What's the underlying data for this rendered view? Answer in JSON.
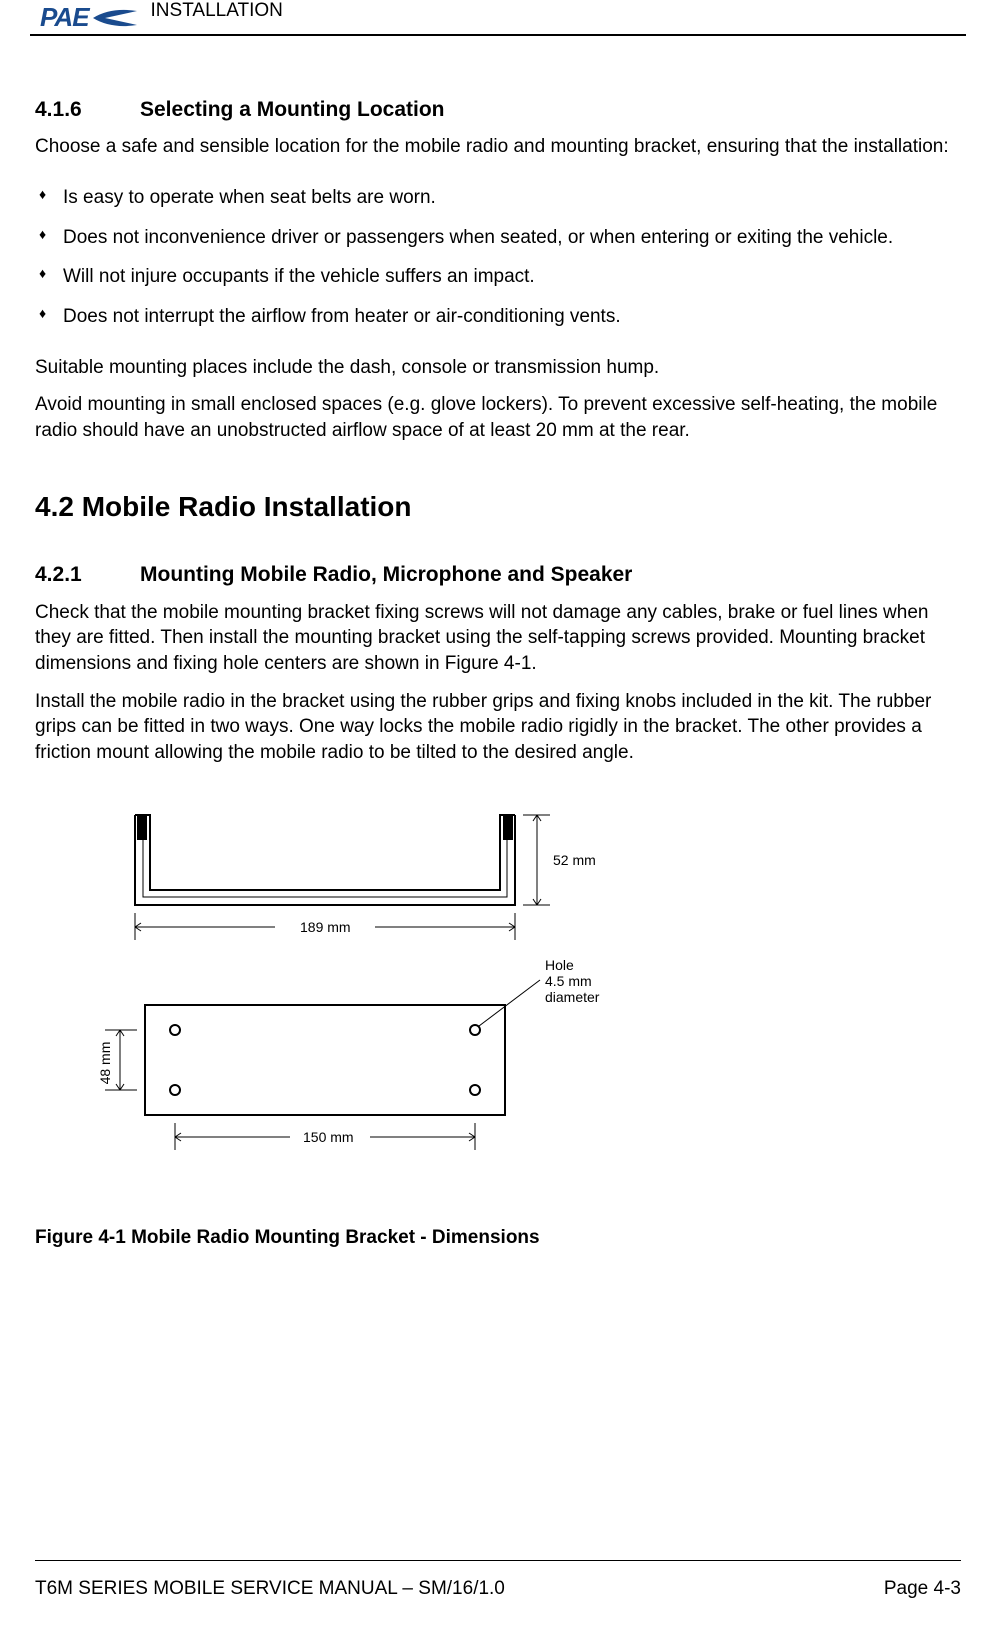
{
  "header": {
    "logo_text": "PAE",
    "title": "INSTALLATION"
  },
  "section_416": {
    "num": "4.1.6",
    "title": "Selecting a Mounting Location",
    "intro": "Choose a safe and sensible location for the mobile radio and mounting bracket, ensuring that the installation:",
    "bullets": [
      "Is easy to operate when seat belts are worn.",
      "Does not inconvenience driver or passengers when seated, or when entering or exiting the vehicle.",
      "Will not injure occupants if the vehicle suffers an impact.",
      "Does not interrupt the airflow from heater or air-conditioning vents."
    ],
    "after1": "Suitable mounting places include the dash, console or transmission hump.",
    "after2": "Avoid mounting in small enclosed spaces (e.g. glove lockers). To prevent excessive self-heating, the mobile radio should have an unobstructed airflow space of at least 20 mm at the rear."
  },
  "section_42": {
    "num": "4.2",
    "title": "Mobile Radio Installation"
  },
  "section_421": {
    "num": "4.2.1",
    "title": "Mounting Mobile Radio, Microphone and Speaker",
    "p1": "Check that the mobile mounting bracket fixing screws will not damage any cables, brake or fuel lines when they are fitted. Then install the mounting bracket using the self-tapping screws provided. Mounting bracket dimensions and fixing hole centers are shown in Figure 4-1.",
    "p2": "Install the mobile radio in the bracket using the rubber grips and fixing knobs included in the kit. The rubber grips can be fitted in two ways. One way locks the mobile radio rigidly in the bracket. The other provides a friction mount allowing the mobile radio to be tilted to the desired angle."
  },
  "figure": {
    "dim_52": "52 mm",
    "dim_189": "189 mm",
    "dim_48": "48 mm",
    "dim_150": "150 mm",
    "hole_l1": "Hole",
    "hole_l2": "4.5 mm",
    "hole_l3": "diameter",
    "caption": "Figure 4-1 Mobile Radio Mounting Bracket - Dimensions"
  },
  "footer": {
    "left": "T6M SERIES MOBILE SERVICE MANUAL – SM/16/1.0",
    "right": "Page 4-3"
  }
}
